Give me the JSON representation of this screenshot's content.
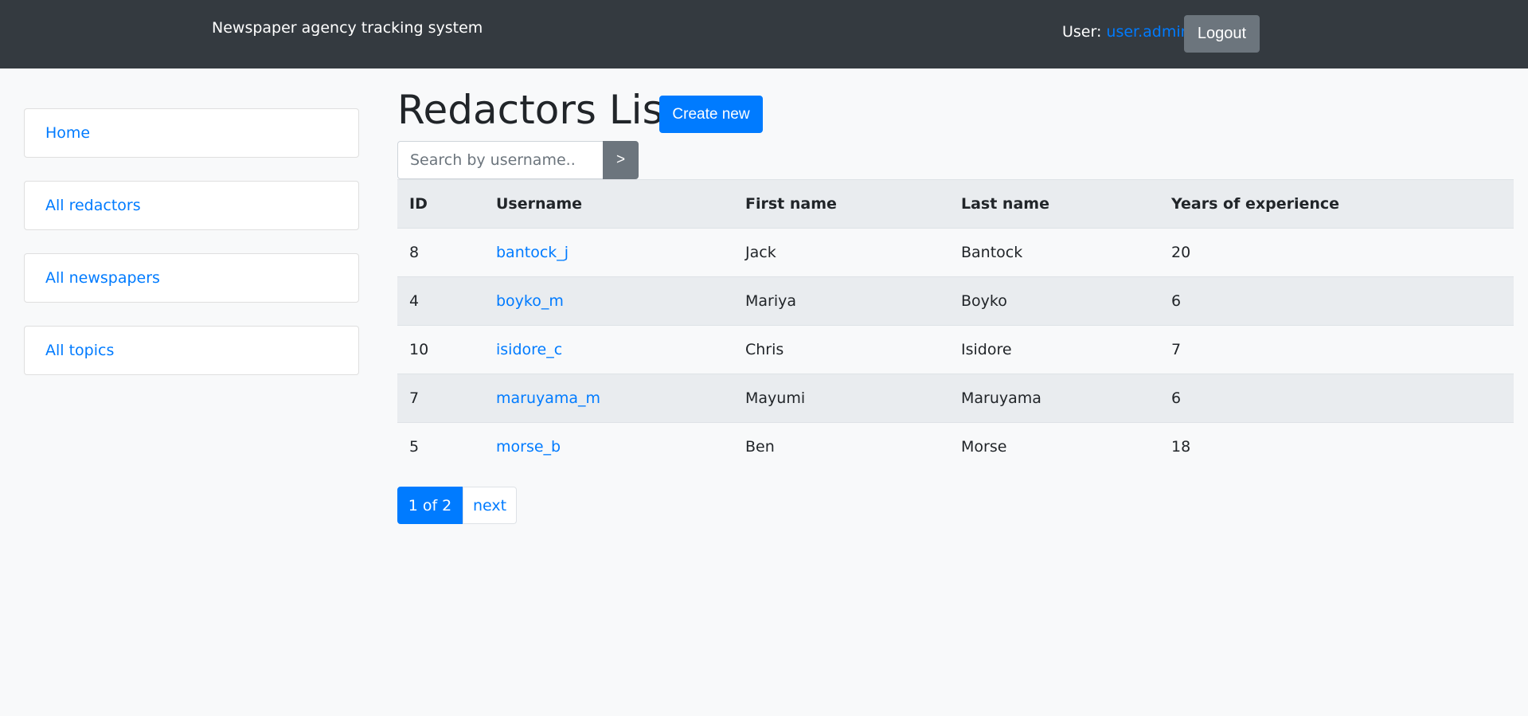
{
  "header": {
    "brand": "Newspaper agency tracking system",
    "user_prefix": "User: ",
    "username": "user.admin",
    "logout_label": "Logout"
  },
  "sidebar": {
    "items": [
      {
        "label": "Home"
      },
      {
        "label": "All redactors"
      },
      {
        "label": "All newspapers"
      },
      {
        "label": "All topics"
      }
    ]
  },
  "main": {
    "title": "Redactors List",
    "create_label": "Create new",
    "search": {
      "placeholder": "Search by username..",
      "button_label": ">"
    },
    "table": {
      "headers": [
        "ID",
        "Username",
        "First name",
        "Last name",
        "Years of experience"
      ],
      "rows": [
        {
          "id": "8",
          "username": "bantock_j",
          "first_name": "Jack",
          "last_name": "Bantock",
          "years": "20"
        },
        {
          "id": "4",
          "username": "boyko_m",
          "first_name": "Mariya",
          "last_name": "Boyko",
          "years": "6"
        },
        {
          "id": "10",
          "username": "isidore_c",
          "first_name": "Chris",
          "last_name": "Isidore",
          "years": "7"
        },
        {
          "id": "7",
          "username": "maruyama_m",
          "first_name": "Mayumi",
          "last_name": "Maruyama",
          "years": "6"
        },
        {
          "id": "5",
          "username": "morse_b",
          "first_name": "Ben",
          "last_name": "Morse",
          "years": "18"
        }
      ]
    },
    "pagination": {
      "current": "1 of 2",
      "next": "next"
    }
  },
  "colors": {
    "navbar": "#343a40",
    "primary": "#007bff",
    "secondary": "#6c757d",
    "page_bg": "#f8f9fa"
  }
}
